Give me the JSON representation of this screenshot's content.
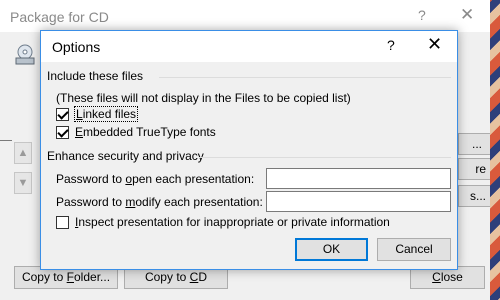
{
  "parent_dialog": {
    "title": "Package for CD",
    "help_glyph": "?",
    "close_glyph": "✕",
    "side_buttons": [
      "...",
      "re",
      "s..."
    ],
    "buttons": {
      "copy_to_folder": {
        "pre": "Copy to ",
        "key": "F",
        "post": "older..."
      },
      "copy_to_cd": {
        "pre": "Copy to ",
        "key": "C",
        "post": "D"
      },
      "close": {
        "pre": "",
        "key": "C",
        "post": "lose"
      }
    }
  },
  "options_dialog": {
    "title": "Options",
    "help_glyph": "?",
    "close_glyph": "✕",
    "include_group": {
      "title": "Include these files",
      "note": "(These files will not display in the Files to be copied list)",
      "linked_files": {
        "key": "L",
        "rest": "inked files",
        "checked": true
      },
      "truetype_fonts": {
        "key": "E",
        "rest": "mbedded TrueType fonts",
        "checked": true
      }
    },
    "security_group": {
      "title": "Enhance security and privacy",
      "open_password": {
        "pre": "Password to ",
        "key": "o",
        "post": "pen each presentation:",
        "value": ""
      },
      "modify_password": {
        "pre": "Password to ",
        "key": "m",
        "post": "odify each presentation:",
        "value": ""
      },
      "inspect": {
        "key": "I",
        "rest": "nspect presentation for inappropriate or private information",
        "checked": false
      }
    },
    "ok_label": "OK",
    "cancel_label": "Cancel"
  },
  "colors": {
    "accent_border": "#0078d7",
    "dialog_bg": "#f0f0f0"
  }
}
